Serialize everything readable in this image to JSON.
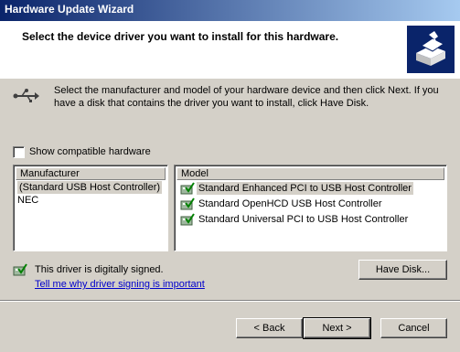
{
  "window": {
    "title": "Hardware Update Wizard"
  },
  "header": {
    "title": "Select the device driver you want to install for this hardware.",
    "icon": "hardware-wizard-icon"
  },
  "instructions": {
    "icon": "usb-icon",
    "text": "Select the manufacturer and model of your hardware device and then click Next. If you have a disk that contains the driver you want to install, click Have Disk."
  },
  "compatible": {
    "label": "Show compatible hardware",
    "checked": false
  },
  "manufacturer": {
    "header": "Manufacturer",
    "items": [
      "(Standard USB Host Controller)",
      "NEC"
    ],
    "selected_index": 0
  },
  "model": {
    "header": "Model",
    "items": [
      "Standard Enhanced PCI to USB Host Controller",
      "Standard OpenHCD USB Host Controller",
      "Standard Universal PCI to USB Host Controller"
    ],
    "selected_index": 0,
    "item_icon": "signed-driver-icon"
  },
  "signature": {
    "text": "This driver is digitally signed.",
    "link": "Tell me why driver signing is important",
    "icon": "signed-driver-icon"
  },
  "buttons": {
    "have_disk": "Have Disk...",
    "back": "< Back",
    "next": "Next >",
    "cancel": "Cancel"
  }
}
